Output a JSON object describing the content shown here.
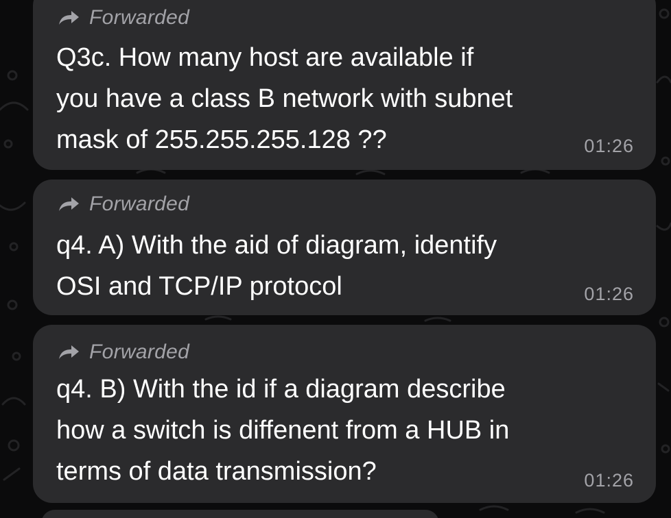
{
  "messages": [
    {
      "forward_label": "Forwarded",
      "lines": [
        "Q3c.  How many host are available if",
        "you have a class B network with subnet",
        "mask of 255.255.255.128 ??"
      ],
      "time": "01:26"
    },
    {
      "forward_label": "Forwarded",
      "lines": [
        "q4. A) With the aid of diagram, identify",
        "OSI and TCP/IP protocol"
      ],
      "time": "01:26"
    },
    {
      "forward_label": "Forwarded",
      "lines": [
        "q4. B) With the id if a diagram describe",
        "how a switch is diffenent from a HUB in",
        "terms of data transmission?"
      ],
      "time": "01:26"
    }
  ],
  "icons": {
    "forward": "forward-arrow-icon"
  },
  "colors": {
    "background": "#0b0b0c",
    "bubble": "#2b2b2d",
    "text": "#ffffff",
    "meta": "#a3a3a8"
  }
}
